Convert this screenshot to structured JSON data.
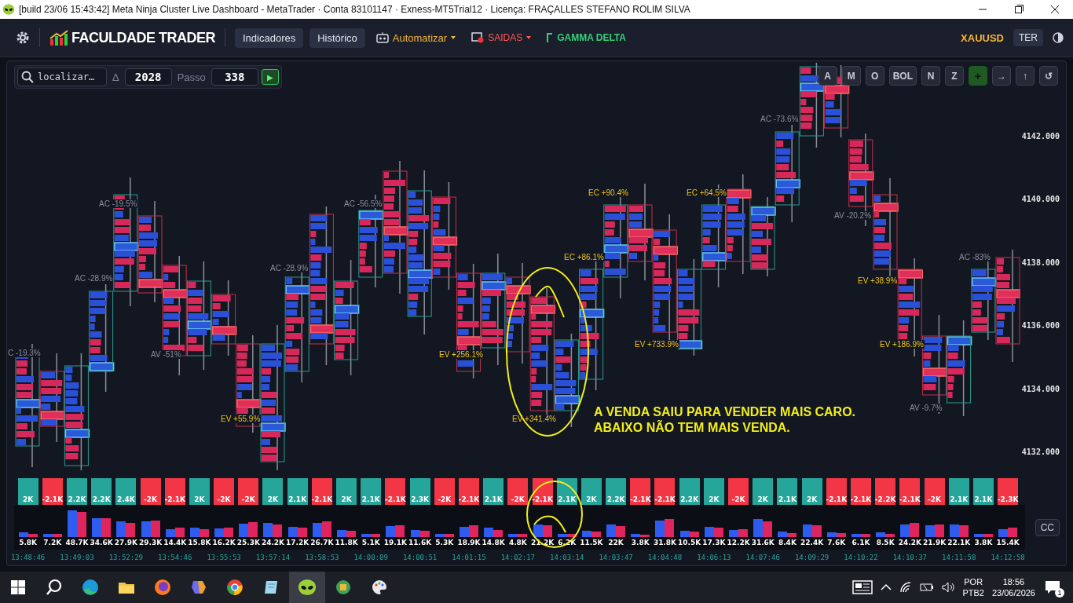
{
  "title_bar": {
    "title": "[build 23/06 15:43:42]  Meta Ninja Cluster Live Dashboard - MetaTrader · Conta 83101147 · Exness-MT5Trial12 · Licença: FRAÇALLES STEFANO ROLIM SILVA"
  },
  "header": {
    "brand": "FACULDADE TRADER",
    "menu": [
      {
        "label": "Indicadores",
        "kind": "pill"
      },
      {
        "label": "Histórico",
        "kind": "pill"
      },
      {
        "label": "Automatizar",
        "kind": "automation"
      },
      {
        "label": "SAIDAS",
        "kind": "exits"
      },
      {
        "label": "GAMMA DELTA",
        "kind": "gamma"
      }
    ],
    "symbol": "XAUUSD",
    "timeframe": "TER"
  },
  "toolbar": {
    "search": {
      "placeholder": "localizar…"
    },
    "delta_label": "Δ",
    "delta_value": "2028",
    "step_label": "Passo",
    "step_value": "338",
    "play": "▶"
  },
  "chart_tools": [
    {
      "label": "A",
      "kind": "plain"
    },
    {
      "label": "M",
      "kind": "plain"
    },
    {
      "label": "O",
      "kind": "plain"
    },
    {
      "label": "BOL",
      "kind": "plain"
    },
    {
      "label": "N",
      "kind": "plain"
    },
    {
      "label": "Z",
      "kind": "plain"
    },
    {
      "label": "+",
      "kind": "accent"
    },
    {
      "label": "→",
      "kind": "plain"
    },
    {
      "label": "↑",
      "kind": "plain"
    },
    {
      "label": "↺",
      "kind": "plain"
    }
  ],
  "price_axis": [
    "4142.000",
    "4140.000",
    "4138.000",
    "4136.000",
    "4134.000",
    "4132.000"
  ],
  "cluster_labels": [
    {
      "text": "C -19.3%",
      "kind": "absorption"
    },
    {
      "text": "AC -19.5%",
      "kind": "absorption"
    },
    {
      "text": "AC -28.9%",
      "kind": "absorption"
    },
    {
      "text": "AV -51%",
      "kind": "absorption"
    },
    {
      "text": "EV +55.9%",
      "kind": "exhaustion"
    },
    {
      "text": "AC -28.9%",
      "kind": "absorption"
    },
    {
      "text": "AC -56.5%",
      "kind": "absorption"
    },
    {
      "text": "EV +256.1%",
      "kind": "exhaustion"
    },
    {
      "text": "EV +341.4%",
      "kind": "exhaustion"
    },
    {
      "text": "EC +86.1%",
      "kind": "exhaustion"
    },
    {
      "text": "EC +90.4%",
      "kind": "exhaustion"
    },
    {
      "text": "EV +733.9%",
      "kind": "exhaustion"
    },
    {
      "text": "EC +64.5%",
      "kind": "exhaustion"
    },
    {
      "text": "AC -73.6%",
      "kind": "absorption"
    },
    {
      "text": "AV -20.2%",
      "kind": "absorption"
    },
    {
      "text": "EV +38.9%",
      "kind": "exhaustion"
    },
    {
      "text": "EV +186.9%",
      "kind": "exhaustion"
    },
    {
      "text": "AV -9.7%",
      "kind": "absorption"
    },
    {
      "text": "AC -83%",
      "kind": "absorption"
    }
  ],
  "note": "A VENDA SAIU PARA VENDER MAIS CARO. ABAIXO NÃO TEM MAIS VENDA.",
  "delta_bars": [
    {
      "value": "2K",
      "color": "#26a69a"
    },
    {
      "value": "-2.1K",
      "color": "#f23645"
    },
    {
      "value": "2.2K",
      "color": "#26a69a"
    },
    {
      "value": "2.2K",
      "color": "#26a69a"
    },
    {
      "value": "2.4K",
      "color": "#26a69a"
    },
    {
      "value": "-2K",
      "color": "#f23645"
    },
    {
      "value": "-2.1K",
      "color": "#f23645"
    },
    {
      "value": "2K",
      "color": "#26a69a"
    },
    {
      "value": "-2K",
      "color": "#f23645"
    },
    {
      "value": "-2K",
      "color": "#f23645"
    },
    {
      "value": "2K",
      "color": "#26a69a"
    },
    {
      "value": "2.1K",
      "color": "#26a69a"
    },
    {
      "value": "-2.1K",
      "color": "#f23645"
    },
    {
      "value": "2K",
      "color": "#26a69a"
    },
    {
      "value": "2.1K",
      "color": "#26a69a"
    },
    {
      "value": "-2.1K",
      "color": "#f23645"
    },
    {
      "value": "2.3K",
      "color": "#26a69a"
    },
    {
      "value": "-2K",
      "color": "#f23645"
    },
    {
      "value": "-2.1K",
      "color": "#f23645"
    },
    {
      "value": "2.1K",
      "color": "#26a69a"
    },
    {
      "value": "-2K",
      "color": "#f23645"
    },
    {
      "value": "-2.1K",
      "color": "#f23645"
    },
    {
      "value": "2.1K",
      "color": "#26a69a"
    },
    {
      "value": "2K",
      "color": "#26a69a"
    },
    {
      "value": "2.2K",
      "color": "#26a69a"
    },
    {
      "value": "-2.1K",
      "color": "#f23645"
    },
    {
      "value": "-2.1K",
      "color": "#f23645"
    },
    {
      "value": "2.2K",
      "color": "#26a69a"
    },
    {
      "value": "2K",
      "color": "#26a69a"
    },
    {
      "value": "-2K",
      "color": "#f23645"
    },
    {
      "value": "2K",
      "color": "#26a69a"
    },
    {
      "value": "2.1K",
      "color": "#26a69a"
    },
    {
      "value": "2K",
      "color": "#26a69a"
    },
    {
      "value": "-2.1K",
      "color": "#f23645"
    },
    {
      "value": "-2.1K",
      "color": "#f23645"
    },
    {
      "value": "-2.2K",
      "color": "#f23645"
    },
    {
      "value": "-2.1K",
      "color": "#f23645"
    },
    {
      "value": "-2K",
      "color": "#f23645"
    },
    {
      "value": "2.1K",
      "color": "#26a69a"
    },
    {
      "value": "2.1K",
      "color": "#26a69a"
    },
    {
      "value": "-2.3K",
      "color": "#f23645"
    }
  ],
  "volume_bars": [
    "5.8K",
    "7.2K",
    "48.7K",
    "34.6K",
    "27.9K",
    "29.3K",
    "14.4K",
    "15.8K",
    "16.2K",
    "25.3K",
    "24.2K",
    "17.2K",
    "26.7K",
    "11.8K",
    "5.1K",
    "19.1K",
    "11.6K",
    "5.3K",
    "18.9K",
    "14.8K",
    "4.8K",
    "21.2K",
    "6.2K",
    "11.5K",
    "22K",
    "3.8K",
    "31.8K",
    "10.5K",
    "17.3K",
    "12.2K",
    "31.6K",
    "8.4K",
    "22.4K",
    "7.6K",
    "6.1K",
    "8.5K",
    "24.2K",
    "21.9K",
    "22.1K",
    "3.8K",
    "15.4K"
  ],
  "cc_button": "CC",
  "time_axis": [
    "13:48:46",
    "13:49:03",
    "13:52:29",
    "13:54:46",
    "13:55:53",
    "13:57:14",
    "13:58:53",
    "14:00:09",
    "14:00:51",
    "14:01:15",
    "14:02:17",
    "14:03:14",
    "14:03:47",
    "14:04:48",
    "14:06:13",
    "14:07:46",
    "14:09:29",
    "14:10:22",
    "14:10:37",
    "14:11:58",
    "14:12:58"
  ],
  "taskbar": {
    "language": "POR",
    "layout": "PTB2",
    "time": "18:56",
    "date": "23/06/2026",
    "notifications": "1"
  }
}
